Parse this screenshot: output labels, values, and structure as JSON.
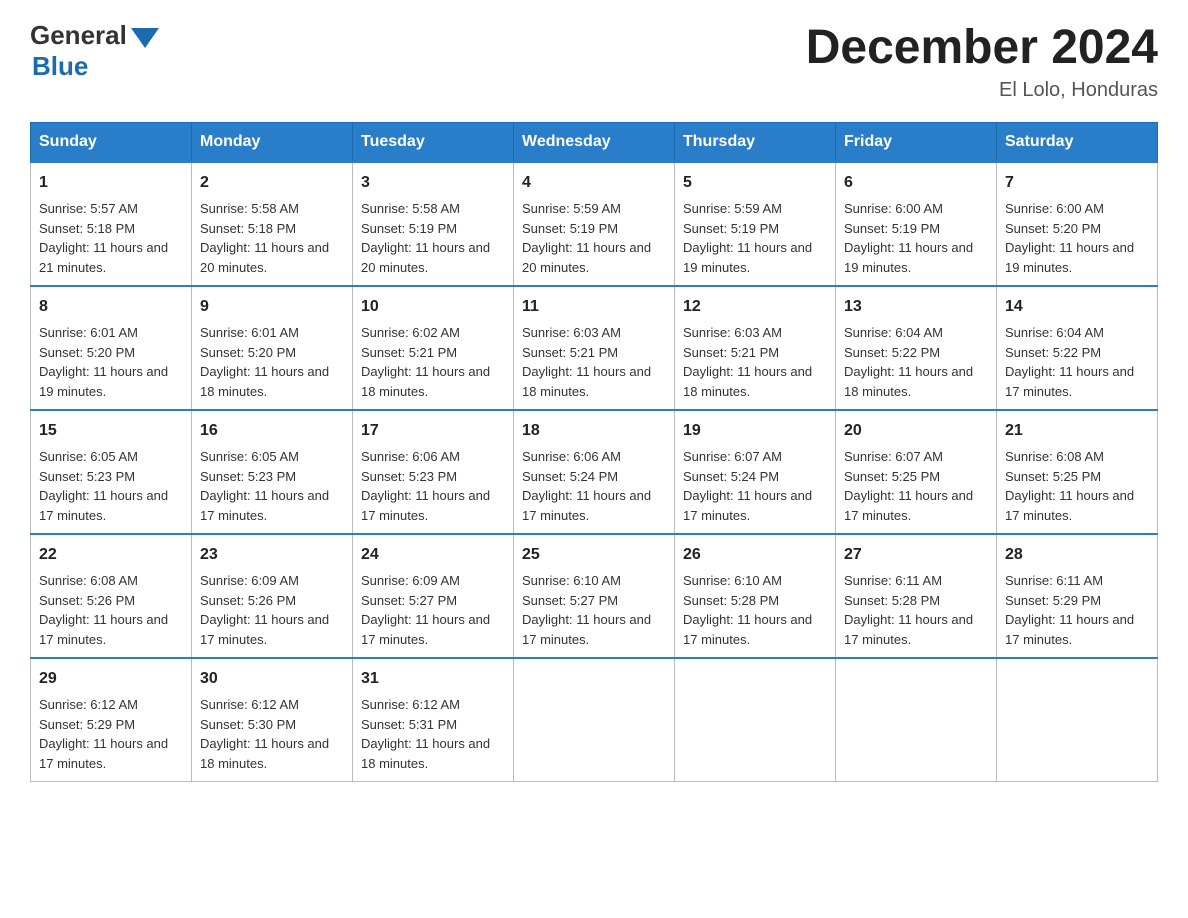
{
  "header": {
    "logo_text_general": "General",
    "logo_text_blue": "Blue",
    "month_title": "December 2024",
    "location": "El Lolo, Honduras"
  },
  "calendar": {
    "days_of_week": [
      "Sunday",
      "Monday",
      "Tuesday",
      "Wednesday",
      "Thursday",
      "Friday",
      "Saturday"
    ],
    "weeks": [
      [
        {
          "day": "1",
          "sunrise": "Sunrise: 5:57 AM",
          "sunset": "Sunset: 5:18 PM",
          "daylight": "Daylight: 11 hours and 21 minutes."
        },
        {
          "day": "2",
          "sunrise": "Sunrise: 5:58 AM",
          "sunset": "Sunset: 5:18 PM",
          "daylight": "Daylight: 11 hours and 20 minutes."
        },
        {
          "day": "3",
          "sunrise": "Sunrise: 5:58 AM",
          "sunset": "Sunset: 5:19 PM",
          "daylight": "Daylight: 11 hours and 20 minutes."
        },
        {
          "day": "4",
          "sunrise": "Sunrise: 5:59 AM",
          "sunset": "Sunset: 5:19 PM",
          "daylight": "Daylight: 11 hours and 20 minutes."
        },
        {
          "day": "5",
          "sunrise": "Sunrise: 5:59 AM",
          "sunset": "Sunset: 5:19 PM",
          "daylight": "Daylight: 11 hours and 19 minutes."
        },
        {
          "day": "6",
          "sunrise": "Sunrise: 6:00 AM",
          "sunset": "Sunset: 5:19 PM",
          "daylight": "Daylight: 11 hours and 19 minutes."
        },
        {
          "day": "7",
          "sunrise": "Sunrise: 6:00 AM",
          "sunset": "Sunset: 5:20 PM",
          "daylight": "Daylight: 11 hours and 19 minutes."
        }
      ],
      [
        {
          "day": "8",
          "sunrise": "Sunrise: 6:01 AM",
          "sunset": "Sunset: 5:20 PM",
          "daylight": "Daylight: 11 hours and 19 minutes."
        },
        {
          "day": "9",
          "sunrise": "Sunrise: 6:01 AM",
          "sunset": "Sunset: 5:20 PM",
          "daylight": "Daylight: 11 hours and 18 minutes."
        },
        {
          "day": "10",
          "sunrise": "Sunrise: 6:02 AM",
          "sunset": "Sunset: 5:21 PM",
          "daylight": "Daylight: 11 hours and 18 minutes."
        },
        {
          "day": "11",
          "sunrise": "Sunrise: 6:03 AM",
          "sunset": "Sunset: 5:21 PM",
          "daylight": "Daylight: 11 hours and 18 minutes."
        },
        {
          "day": "12",
          "sunrise": "Sunrise: 6:03 AM",
          "sunset": "Sunset: 5:21 PM",
          "daylight": "Daylight: 11 hours and 18 minutes."
        },
        {
          "day": "13",
          "sunrise": "Sunrise: 6:04 AM",
          "sunset": "Sunset: 5:22 PM",
          "daylight": "Daylight: 11 hours and 18 minutes."
        },
        {
          "day": "14",
          "sunrise": "Sunrise: 6:04 AM",
          "sunset": "Sunset: 5:22 PM",
          "daylight": "Daylight: 11 hours and 17 minutes."
        }
      ],
      [
        {
          "day": "15",
          "sunrise": "Sunrise: 6:05 AM",
          "sunset": "Sunset: 5:23 PM",
          "daylight": "Daylight: 11 hours and 17 minutes."
        },
        {
          "day": "16",
          "sunrise": "Sunrise: 6:05 AM",
          "sunset": "Sunset: 5:23 PM",
          "daylight": "Daylight: 11 hours and 17 minutes."
        },
        {
          "day": "17",
          "sunrise": "Sunrise: 6:06 AM",
          "sunset": "Sunset: 5:23 PM",
          "daylight": "Daylight: 11 hours and 17 minutes."
        },
        {
          "day": "18",
          "sunrise": "Sunrise: 6:06 AM",
          "sunset": "Sunset: 5:24 PM",
          "daylight": "Daylight: 11 hours and 17 minutes."
        },
        {
          "day": "19",
          "sunrise": "Sunrise: 6:07 AM",
          "sunset": "Sunset: 5:24 PM",
          "daylight": "Daylight: 11 hours and 17 minutes."
        },
        {
          "day": "20",
          "sunrise": "Sunrise: 6:07 AM",
          "sunset": "Sunset: 5:25 PM",
          "daylight": "Daylight: 11 hours and 17 minutes."
        },
        {
          "day": "21",
          "sunrise": "Sunrise: 6:08 AM",
          "sunset": "Sunset: 5:25 PM",
          "daylight": "Daylight: 11 hours and 17 minutes."
        }
      ],
      [
        {
          "day": "22",
          "sunrise": "Sunrise: 6:08 AM",
          "sunset": "Sunset: 5:26 PM",
          "daylight": "Daylight: 11 hours and 17 minutes."
        },
        {
          "day": "23",
          "sunrise": "Sunrise: 6:09 AM",
          "sunset": "Sunset: 5:26 PM",
          "daylight": "Daylight: 11 hours and 17 minutes."
        },
        {
          "day": "24",
          "sunrise": "Sunrise: 6:09 AM",
          "sunset": "Sunset: 5:27 PM",
          "daylight": "Daylight: 11 hours and 17 minutes."
        },
        {
          "day": "25",
          "sunrise": "Sunrise: 6:10 AM",
          "sunset": "Sunset: 5:27 PM",
          "daylight": "Daylight: 11 hours and 17 minutes."
        },
        {
          "day": "26",
          "sunrise": "Sunrise: 6:10 AM",
          "sunset": "Sunset: 5:28 PM",
          "daylight": "Daylight: 11 hours and 17 minutes."
        },
        {
          "day": "27",
          "sunrise": "Sunrise: 6:11 AM",
          "sunset": "Sunset: 5:28 PM",
          "daylight": "Daylight: 11 hours and 17 minutes."
        },
        {
          "day": "28",
          "sunrise": "Sunrise: 6:11 AM",
          "sunset": "Sunset: 5:29 PM",
          "daylight": "Daylight: 11 hours and 17 minutes."
        }
      ],
      [
        {
          "day": "29",
          "sunrise": "Sunrise: 6:12 AM",
          "sunset": "Sunset: 5:29 PM",
          "daylight": "Daylight: 11 hours and 17 minutes."
        },
        {
          "day": "30",
          "sunrise": "Sunrise: 6:12 AM",
          "sunset": "Sunset: 5:30 PM",
          "daylight": "Daylight: 11 hours and 18 minutes."
        },
        {
          "day": "31",
          "sunrise": "Sunrise: 6:12 AM",
          "sunset": "Sunset: 5:31 PM",
          "daylight": "Daylight: 11 hours and 18 minutes."
        },
        null,
        null,
        null,
        null
      ]
    ]
  }
}
